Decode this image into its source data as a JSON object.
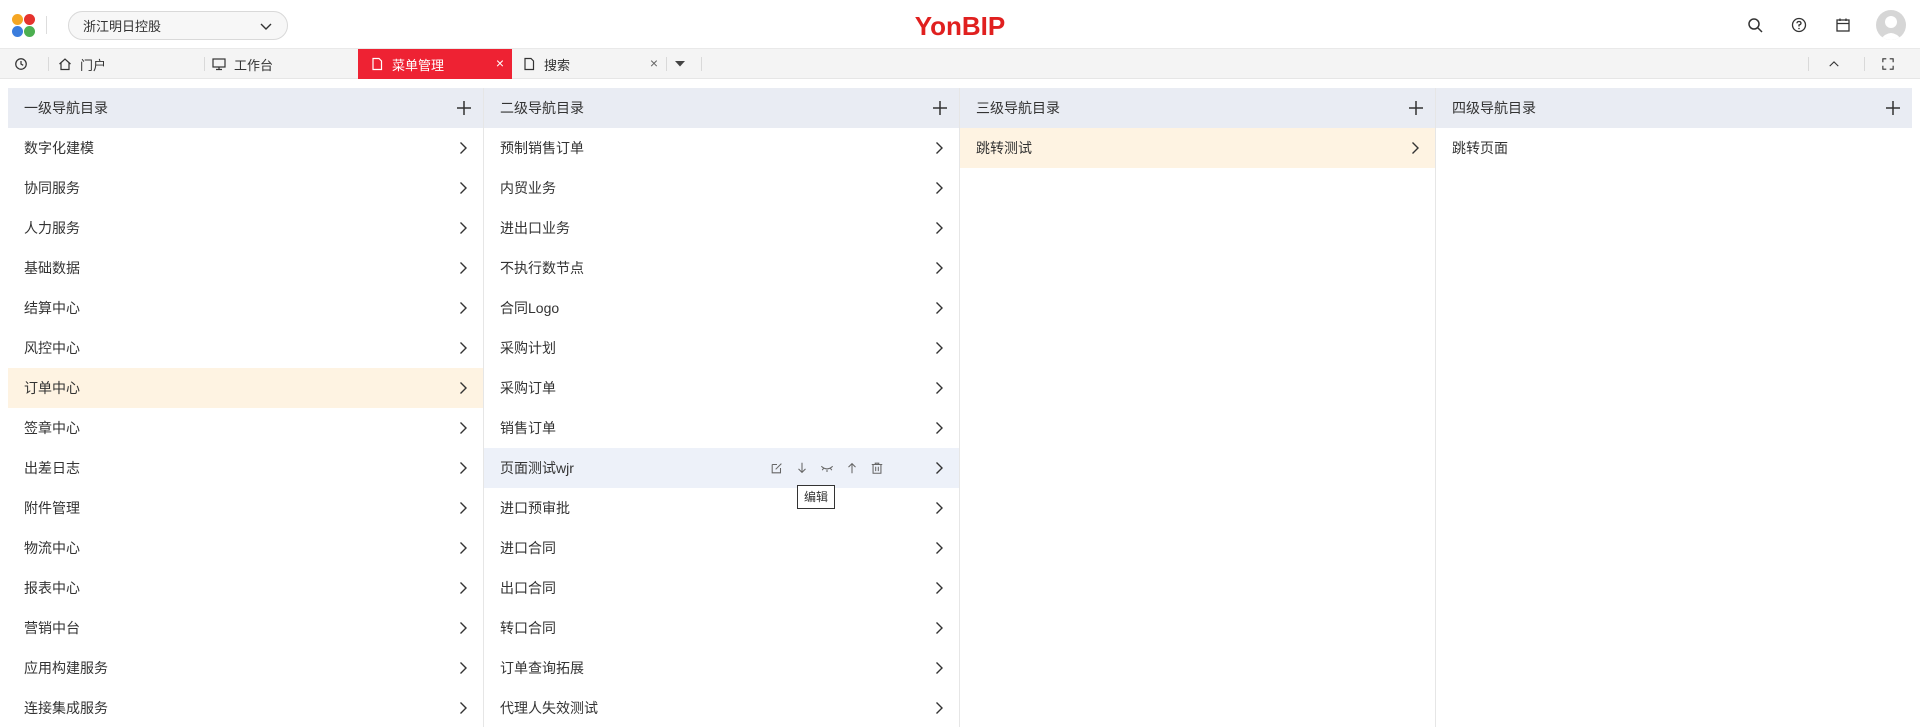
{
  "header": {
    "org_select": "浙江明日控股",
    "brand": "YonBIP"
  },
  "tabs": [
    {
      "label": "门户",
      "icon": "home-icon"
    },
    {
      "label": "工作台",
      "icon": "monitor-icon"
    },
    {
      "label": "菜单管理",
      "icon": "document-icon",
      "active": true,
      "close": "×"
    },
    {
      "label": "搜索",
      "icon": "document-icon",
      "close": "×"
    }
  ],
  "columns": [
    {
      "title": "一级导航目录",
      "items": [
        "数字化建模",
        "协同服务",
        "人力服务",
        "基础数据",
        "结算中心",
        "风控中心",
        "订单中心",
        "签章中心",
        "出差日志",
        "附件管理",
        "物流中心",
        "报表中心",
        "营销中台",
        "应用构建服务",
        "连接集成服务"
      ],
      "selected_index": 6
    },
    {
      "title": "二级导航目录",
      "items": [
        "预制销售订单",
        "内贸业务",
        "进出口业务",
        "不执行数节点",
        "合同Logo",
        "采购计划",
        "采购订单",
        "销售订单",
        "页面测试wjr",
        "进口预审批",
        "进口合同",
        "出口合同",
        "转口合同",
        "订单查询拓展",
        "代理人失效测试"
      ],
      "hovered_index": 8
    },
    {
      "title": "三级导航目录",
      "items": [
        "跳转测试"
      ],
      "selected_index": 0
    },
    {
      "title": "四级导航目录",
      "items": [
        "跳转页面"
      ]
    }
  ],
  "tooltip": "编辑",
  "colors": {
    "brand": "#e0201f",
    "active_tab": "#ee2233",
    "column_header": "#e9ecf3",
    "selected_row": "#fef3e2",
    "hovered_row": "#edf1f9"
  }
}
